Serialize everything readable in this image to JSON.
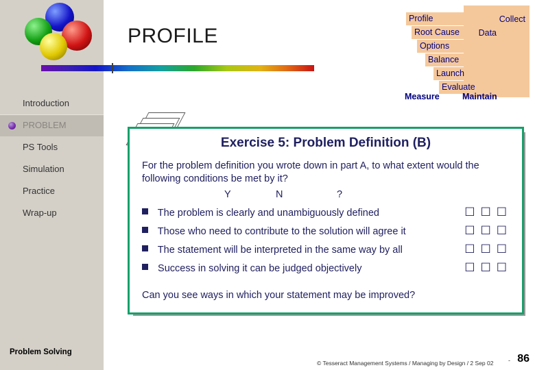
{
  "header": {
    "title": "PROFILE",
    "logo_icon": "four-spheres-logo",
    "rainbow_bar_icon": "spectrum-bar"
  },
  "funnel": {
    "steps": [
      "Profile",
      "Root Cause",
      "Options",
      "Balance",
      "Launch",
      "Evaluate",
      "Measure"
    ],
    "side_label_line1": "Collect",
    "side_label_line2": "Data",
    "side_label_right": "Maintain",
    "color": "#f5c89b",
    "text_color": "#000080"
  },
  "sidebar": {
    "items": [
      {
        "label": "Introduction",
        "active": false
      },
      {
        "label": "PROBLEM",
        "active": true
      },
      {
        "label": "PS Tools",
        "active": false
      },
      {
        "label": "Simulation",
        "active": false
      },
      {
        "label": "Practice",
        "active": false
      },
      {
        "label": "Wrap-up",
        "active": false
      }
    ],
    "footer": "Problem Solving"
  },
  "card": {
    "title": "Exercise 5: Problem Definition (B)",
    "intro": "For the problem definition you wrote down in part A, to what extent would the following conditions be met by it?",
    "columns": [
      "Y",
      "N",
      "?"
    ],
    "questions": [
      "The problem is clearly and unambiguously defined",
      "Those who need to contribute to the solution will agree it",
      "The statement will be interpreted in the same way by all",
      "Success in solving it can be judged objectively"
    ],
    "checkbox_glyph": "☐☐☐",
    "closing": "Can you see ways in which your statement may be improved?",
    "border_color": "#16a06a"
  },
  "footer": {
    "copyright": "© Tesseract Management Systems / Managing by Design / 2 Sep 02",
    "page_dash": "-",
    "page_number": "86"
  }
}
